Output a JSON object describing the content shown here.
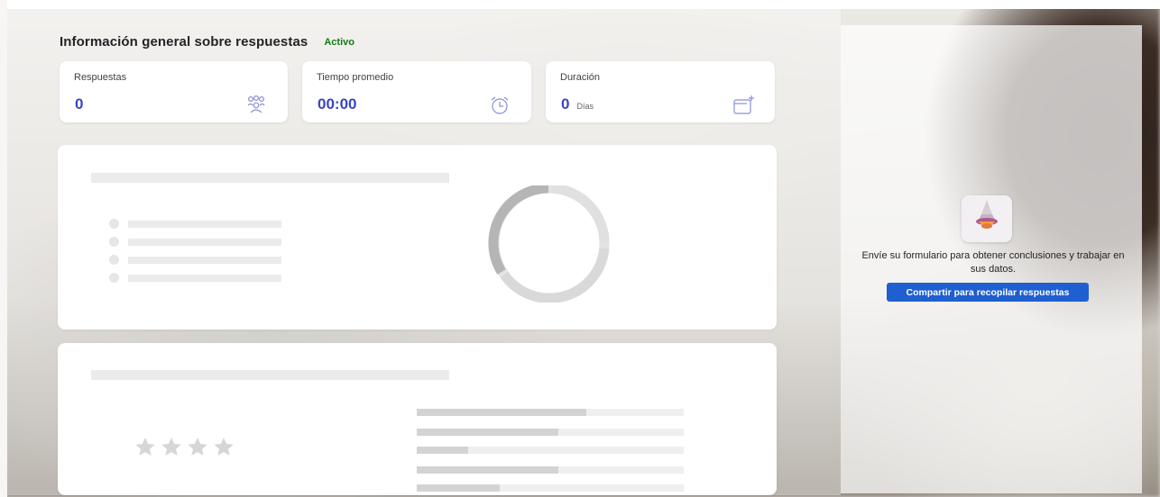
{
  "header": {
    "title": "Información general sobre respuestas",
    "status": "Activo"
  },
  "stats": [
    {
      "label": "Respuestas",
      "value": "0",
      "icon": "people-icon"
    },
    {
      "label": "Tiempo promedio",
      "value": "00:00",
      "icon": "alarm-clock-icon"
    },
    {
      "label": "Duración",
      "value": "0",
      "unit": "Días",
      "icon": "calendar-add-icon"
    }
  ],
  "share": {
    "icon": "forms-share-icon",
    "text": "Envíe su formulario para obtener conclusiones y trabajar en sus datos.",
    "button_label": "Compartir para recopilar respuestas"
  },
  "colors": {
    "accent": "#3b45c4",
    "status": "#107c10",
    "button": "#1f5fcf"
  }
}
